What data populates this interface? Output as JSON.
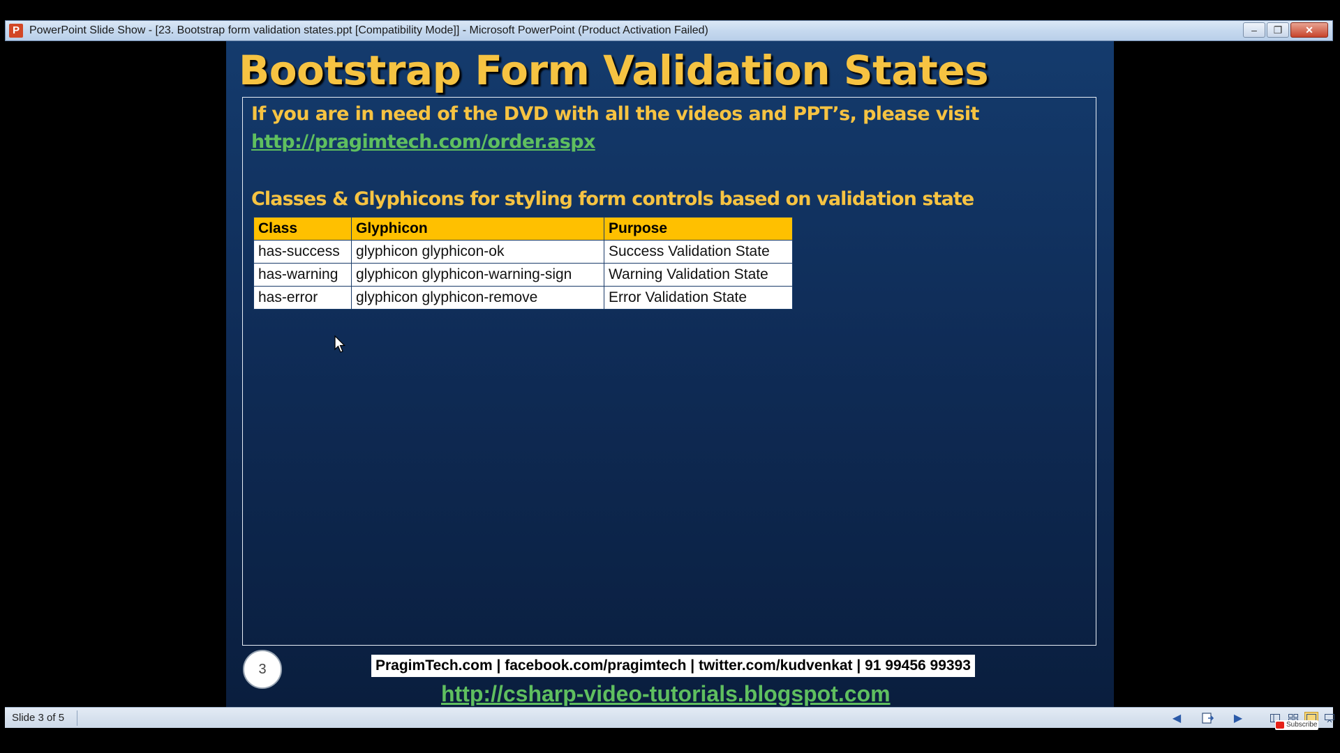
{
  "window": {
    "app_icon": "P",
    "title": "PowerPoint Slide Show - [23. Bootstrap form validation states.ppt [Compatibility Mode]] - Microsoft PowerPoint (Product Activation Failed)",
    "minimize_icon": "–",
    "maximize_icon": "❐",
    "close_icon": "✕"
  },
  "slide": {
    "title": "Bootstrap Form Validation States",
    "dvd_text": "If you are in need of the DVD with all the videos and PPT’s, please visit",
    "order_link": "http://pragimtech.com/order.aspx",
    "classes_heading": "Classes & Glyphicons for styling form controls based on validation state",
    "table": {
      "headers": [
        "Class",
        "Glyphicon",
        "Purpose"
      ],
      "rows": [
        [
          "has-success",
          "glyphicon glyphicon-ok",
          "Success Validation State"
        ],
        [
          "has-warning",
          "glyphicon glyphicon-warning-sign",
          "Warning Validation State"
        ],
        [
          "has-error",
          "glyphicon glyphicon-remove",
          "Error Validation State"
        ]
      ]
    },
    "slide_number": "3",
    "footer_contacts": "PragimTech.com | facebook.com/pragimtech  | twitter.com/kudvenkat  | 91 99456 99393",
    "blog_link": "http://csharp-video-tutorials.blogspot.com"
  },
  "statusbar": {
    "slide_indicator": "Slide 3 of 5",
    "prev_icon": "previous-arrow-icon",
    "menu_icon": "slideshow-menu-icon",
    "next_icon": "next-arrow-icon",
    "subscribe_label": "Subscribe"
  },
  "colors": {
    "title_yellow": "#f6c342",
    "link_green": "#5fbf5f",
    "table_header": "#ffc000",
    "slide_bg_top": "#143b6d",
    "slide_bg_bottom": "#0a1e3e"
  }
}
